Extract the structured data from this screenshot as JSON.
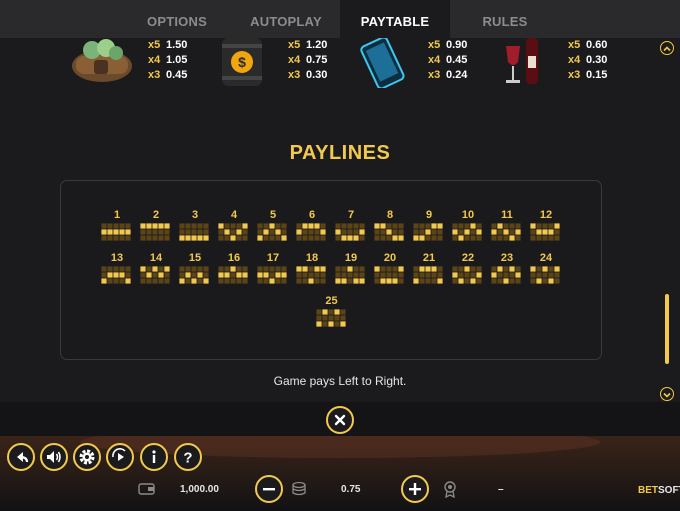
{
  "tabs": [
    {
      "label": "OPTIONS",
      "active": false
    },
    {
      "label": "AUTOPLAY",
      "active": false
    },
    {
      "label": "PAYTABLE",
      "active": true
    },
    {
      "label": "RULES",
      "active": false
    }
  ],
  "symbols": [
    {
      "icon": "money-bag-icon",
      "pays": [
        {
          "m": "x5",
          "v": "1.50"
        },
        {
          "m": "x4",
          "v": "1.05"
        },
        {
          "m": "x3",
          "v": "0.45"
        }
      ]
    },
    {
      "icon": "oil-barrel-icon",
      "pays": [
        {
          "m": "x5",
          "v": "1.20"
        },
        {
          "m": "x4",
          "v": "0.75"
        },
        {
          "m": "x3",
          "v": "0.30"
        }
      ]
    },
    {
      "icon": "phone-icon",
      "pays": [
        {
          "m": "x5",
          "v": "0.90"
        },
        {
          "m": "x4",
          "v": "0.45"
        },
        {
          "m": "x3",
          "v": "0.24"
        }
      ]
    },
    {
      "icon": "wine-icon",
      "pays": [
        {
          "m": "x5",
          "v": "0.60"
        },
        {
          "m": "x4",
          "v": "0.30"
        },
        {
          "m": "x3",
          "v": "0.15"
        }
      ]
    }
  ],
  "paylines_title": "PAYLINES",
  "paylines": [
    {
      "n": "1",
      "rows": [
        1,
        1,
        1,
        1,
        1
      ]
    },
    {
      "n": "2",
      "rows": [
        0,
        0,
        0,
        0,
        0
      ]
    },
    {
      "n": "3",
      "rows": [
        2,
        2,
        2,
        2,
        2
      ]
    },
    {
      "n": "4",
      "rows": [
        0,
        1,
        2,
        1,
        0
      ]
    },
    {
      "n": "5",
      "rows": [
        2,
        1,
        0,
        1,
        2
      ]
    },
    {
      "n": "6",
      "rows": [
        1,
        0,
        0,
        0,
        1
      ]
    },
    {
      "n": "7",
      "rows": [
        1,
        2,
        2,
        2,
        1
      ]
    },
    {
      "n": "8",
      "rows": [
        0,
        0,
        1,
        2,
        2
      ]
    },
    {
      "n": "9",
      "rows": [
        2,
        2,
        1,
        0,
        0
      ]
    },
    {
      "n": "10",
      "rows": [
        1,
        2,
        1,
        0,
        1
      ]
    },
    {
      "n": "11",
      "rows": [
        1,
        0,
        1,
        2,
        1
      ]
    },
    {
      "n": "12",
      "rows": [
        0,
        1,
        1,
        1,
        0
      ]
    },
    {
      "n": "13",
      "rows": [
        2,
        1,
        1,
        1,
        2
      ]
    },
    {
      "n": "14",
      "rows": [
        0,
        1,
        0,
        1,
        0
      ]
    },
    {
      "n": "15",
      "rows": [
        2,
        1,
        2,
        1,
        2
      ]
    },
    {
      "n": "16",
      "rows": [
        1,
        1,
        0,
        1,
        1
      ]
    },
    {
      "n": "17",
      "rows": [
        1,
        1,
        2,
        1,
        1
      ]
    },
    {
      "n": "18",
      "rows": [
        0,
        0,
        2,
        0,
        0
      ]
    },
    {
      "n": "19",
      "rows": [
        2,
        2,
        0,
        2,
        2
      ]
    },
    {
      "n": "20",
      "rows": [
        0,
        2,
        2,
        2,
        0
      ]
    },
    {
      "n": "21",
      "rows": [
        2,
        0,
        0,
        0,
        2
      ]
    },
    {
      "n": "22",
      "rows": [
        1,
        2,
        0,
        2,
        1
      ]
    },
    {
      "n": "23",
      "rows": [
        1,
        0,
        2,
        0,
        1
      ]
    },
    {
      "n": "24",
      "rows": [
        0,
        2,
        0,
        2,
        0
      ]
    },
    {
      "n": "25",
      "rows": [
        2,
        0,
        2,
        0,
        2
      ]
    }
  ],
  "note": "Game pays Left to Right.",
  "scroll_position": 0.92,
  "bottom": {
    "balance": "1,000.00",
    "bet": "0.75",
    "win": "–",
    "brand_a": "BET",
    "brand_b": "SOFT"
  },
  "colors": {
    "accent": "#f2c94c",
    "panel": "#1b1b1d",
    "tabbar": "#2a2a2c"
  }
}
